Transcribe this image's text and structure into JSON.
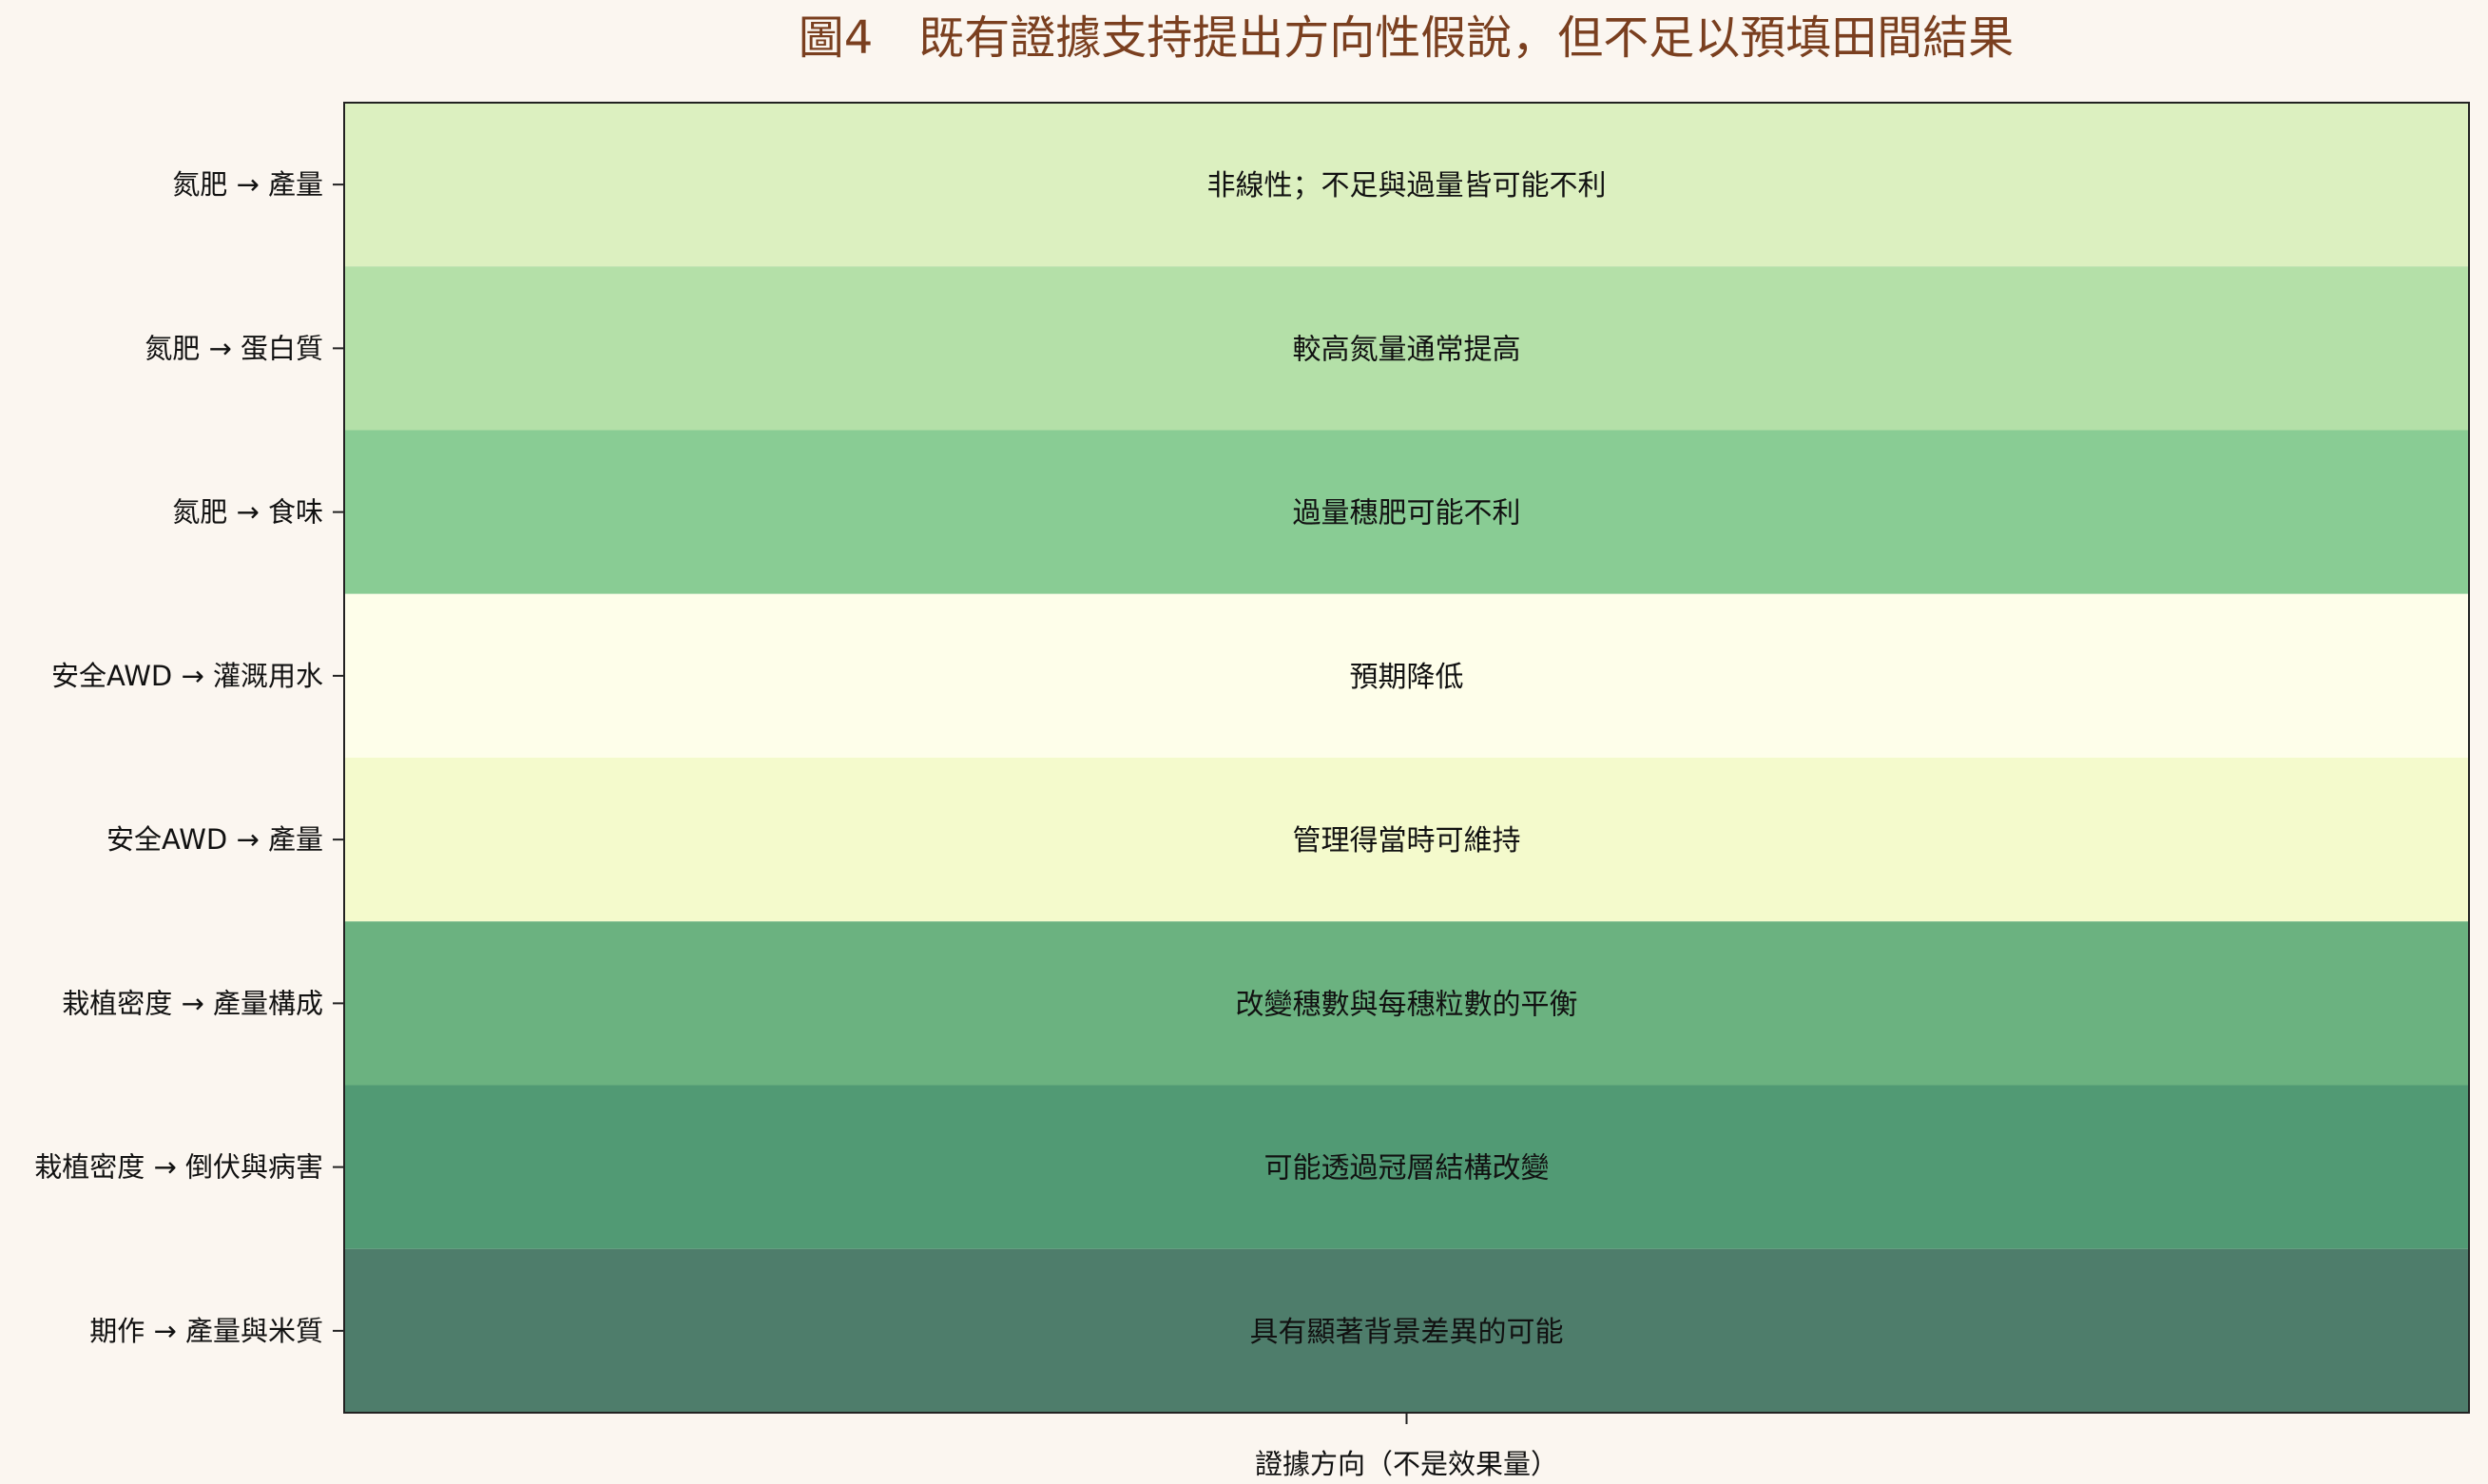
{
  "chart_data": {
    "type": "heatmap",
    "title": "圖4　既有證據支持提出方向性假說，但不足以預填田間結果",
    "xlabel": "證據方向（不是效果量）",
    "ylabel": "",
    "rows": [
      {
        "label": "氮肥 → 產量",
        "text": "非線性；不足與過量皆可能不利",
        "color": "#dcf0c0"
      },
      {
        "label": "氮肥 → 蛋白質",
        "text": "較高氮量通常提高",
        "color": "#b4e0a8"
      },
      {
        "label": "氮肥 → 食味",
        "text": "過量穗肥可能不利",
        "color": "#89cc94"
      },
      {
        "label": "安全AWD → 灌溉用水",
        "text": "預期降低",
        "color": "#fefeea"
      },
      {
        "label": "安全AWD → 產量",
        "text": "管理得當時可維持",
        "color": "#f4facc"
      },
      {
        "label": "栽植密度 → 產量構成",
        "text": "改變穗數與每穗粒數的平衡",
        "color": "#6bb280"
      },
      {
        "label": "栽植密度 → 倒伏與病害",
        "text": "可能透過冠層結構改變",
        "color": "#519a74"
      },
      {
        "label": "期作 → 產量與米質",
        "text": "具有顯著背景差異的可能",
        "color": "#4e7d6b"
      }
    ],
    "grid": false
  }
}
